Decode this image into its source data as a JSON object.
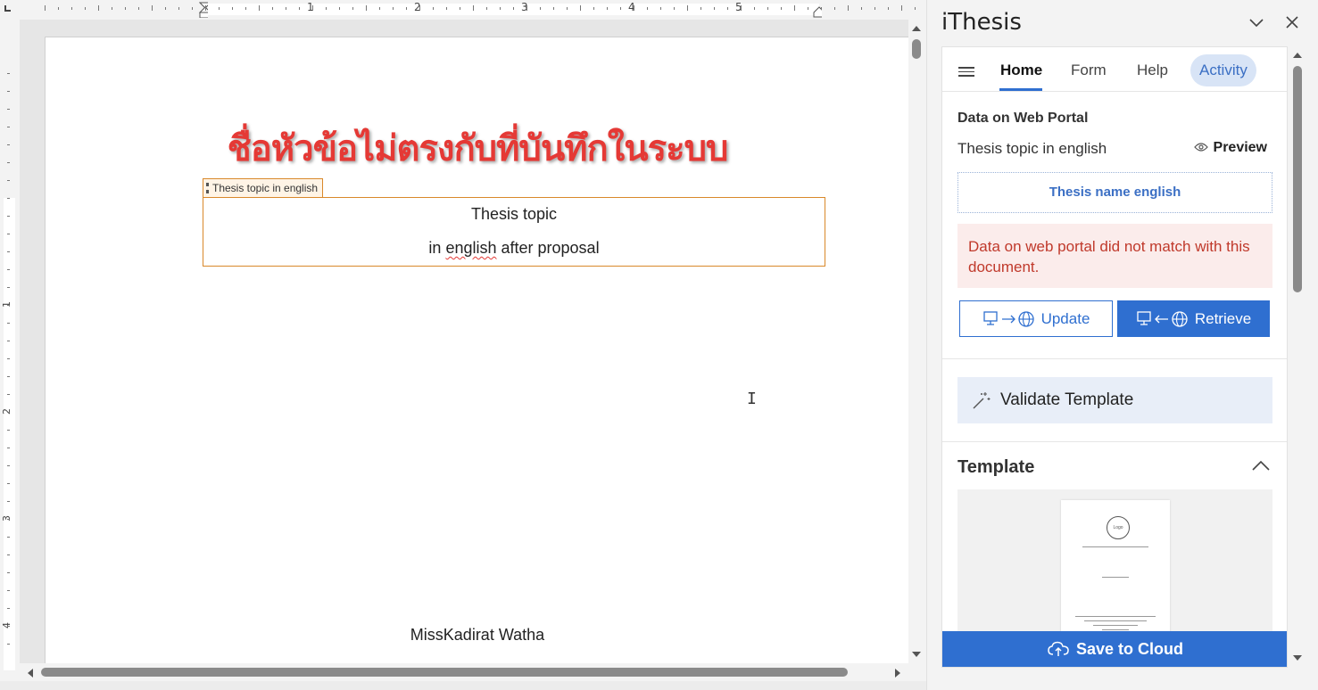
{
  "ruler": {
    "numbers": [
      "1",
      "2",
      "3",
      "4",
      "5"
    ],
    "v_numbers": [
      "1",
      "2",
      "3",
      "4"
    ]
  },
  "document": {
    "warning_thai": "ชื่อหัวข้อไม่ตรงกับที่บันทึกในระบบ",
    "content_control_tag": "Thesis topic in english",
    "topic_line1": "Thesis topic",
    "topic_line2_word1": "in",
    "topic_line2_misspelled": "english",
    "topic_line2_rest": "after proposal",
    "author": "MissKadirat Watha"
  },
  "pane": {
    "title": "iThesis",
    "tabs": {
      "home": "Home",
      "form": "Form",
      "help": "Help",
      "activity": "Activity"
    },
    "section_title": "Data on Web Portal",
    "field_label": "Thesis topic in english",
    "preview_label": "Preview",
    "thesis_name_value": "Thesis name english",
    "alert_text": "Data on web portal did not match with this document.",
    "update_label": "Update",
    "retrieve_label": "Retrieve",
    "validate_label": "Validate Template",
    "template_title": "Template",
    "template_thumb_text": "Logo",
    "save_label": "Save to Cloud"
  },
  "colors": {
    "accent": "#2f6fd0",
    "alert_bg": "#fbeceb",
    "alert_text": "#c0392b",
    "warning_red": "#e53935",
    "content_control": "#d9882a"
  },
  "icons": [
    "hamburger-icon",
    "eye-icon",
    "computer-icon",
    "arrow-right-icon",
    "arrow-left-icon",
    "globe-icon",
    "magic-wand-icon",
    "chevron-up-icon",
    "chevron-down-icon",
    "close-icon",
    "cloud-upload-icon"
  ]
}
